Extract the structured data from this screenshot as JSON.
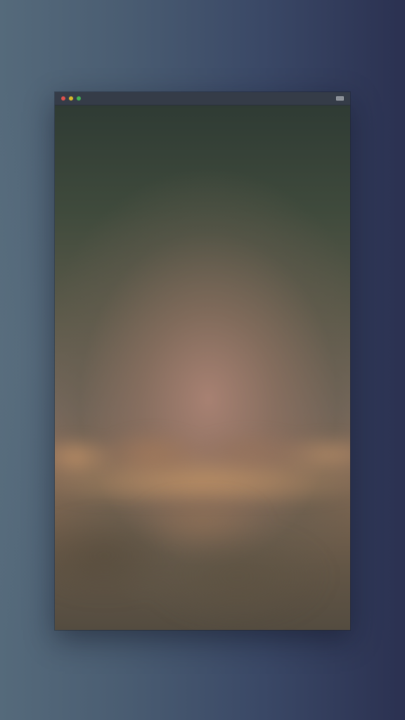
{
  "window": {
    "controls": [
      {
        "name": "close",
        "color": "#e0524d"
      },
      {
        "name": "minimize",
        "color": "#d9b92b"
      },
      {
        "name": "zoom",
        "color": "#43b555"
      }
    ],
    "menu_icon": "window-menu-icon"
  },
  "content": {
    "scene": "sky-above-clouds-image",
    "colors": {
      "sky_top": "#2f3b34",
      "glow": "#aa8273",
      "clouds": "#b98c64",
      "bottom": "#544c40"
    }
  },
  "desktop": {
    "colors": {
      "left": "#556a7b",
      "right": "#2b3151"
    }
  }
}
